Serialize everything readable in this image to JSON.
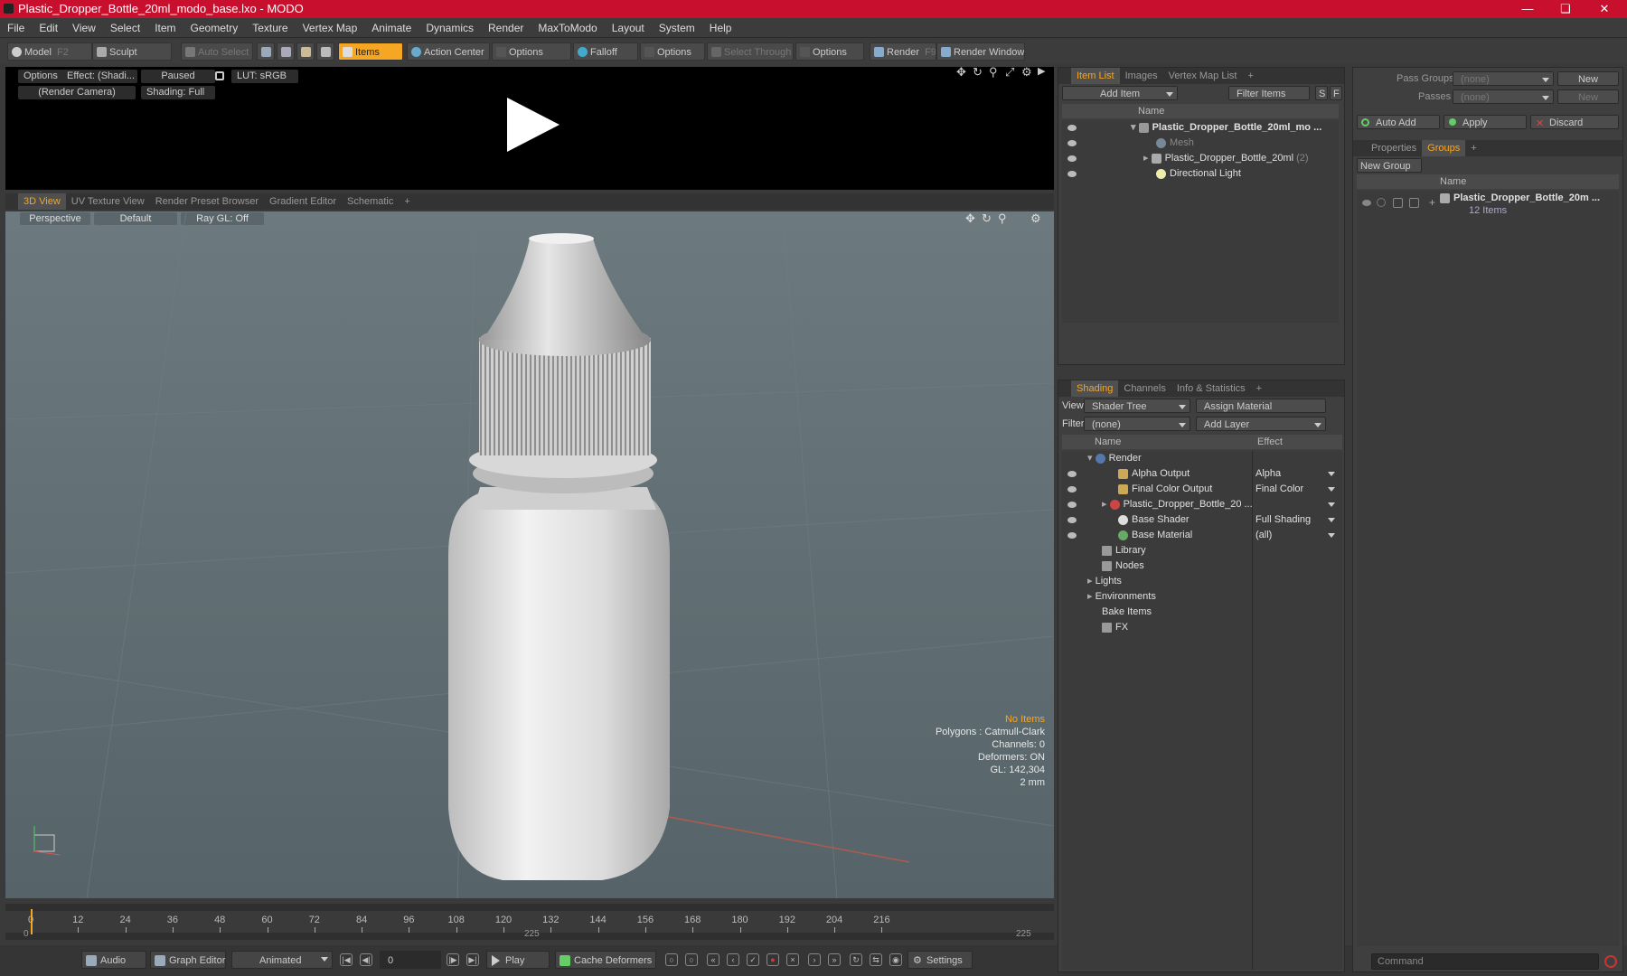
{
  "title": "Plastic_Dropper_Bottle_20ml_modo_base.lxo - MODO",
  "menu": [
    "File",
    "Edit",
    "View",
    "Select",
    "Item",
    "Geometry",
    "Texture",
    "Vertex Map",
    "Animate",
    "Dynamics",
    "Render",
    "MaxToModo",
    "Layout",
    "System",
    "Help"
  ],
  "toolbar": {
    "model": "Model",
    "model_key": "F2",
    "sculpt": "Sculpt",
    "auto_select": "Auto Select",
    "items": "Items",
    "action_center": "Action Center",
    "options1": "Options",
    "falloff": "Falloff",
    "options2": "Options",
    "select_through": "Select Through",
    "options3": "Options",
    "render": "Render",
    "render_key": "F9",
    "render_window": "Render Window"
  },
  "render_preview": {
    "options": "Options",
    "effect": "Effect: (Shadi...",
    "paused": "Paused",
    "lut": "LUT: sRGB",
    "camera": "(Render Camera)",
    "shading": "Shading: Full"
  },
  "viewport_tabs": [
    "3D View",
    "UV Texture View",
    "Render Preset Browser",
    "Gradient Editor",
    "Schematic",
    "+"
  ],
  "viewport": {
    "perspective": "Perspective",
    "default": "Default",
    "raygl": "Ray GL: Off",
    "stats": [
      "No Items",
      "Polygons : Catmull-Clark",
      "Channels: 0",
      "Deformers: ON",
      "GL: 142,304",
      "2 mm"
    ]
  },
  "timeline": {
    "ticks": [
      "0",
      "12",
      "24",
      "36",
      "48",
      "60",
      "72",
      "84",
      "96",
      "108",
      "120",
      "132",
      "144",
      "156",
      "168",
      "180",
      "192",
      "204",
      "216"
    ],
    "start": "0",
    "mid": "225",
    "end": "225"
  },
  "bottom": {
    "audio": "Audio",
    "graph_editor": "Graph Editor",
    "animated": "Animated",
    "frame": "0",
    "play": "Play",
    "cache_deformers": "Cache Deformers",
    "settings": "Settings"
  },
  "item_list": {
    "tabs": [
      "Item List",
      "Images",
      "Vertex Map List",
      "+"
    ],
    "add_item": "Add Item",
    "filter_items": "Filter Items",
    "s": "S",
    "f": "F",
    "col_name": "Name",
    "rows": [
      {
        "label": "Plastic_Dropper_Bottle_20ml_mo ...",
        "extra": ""
      },
      {
        "label": "Mesh",
        "extra": ""
      },
      {
        "label": "Plastic_Dropper_Bottle_20ml",
        "extra": "(2)"
      },
      {
        "label": "Directional Light",
        "extra": ""
      }
    ]
  },
  "shading": {
    "tabs": [
      "Shading",
      "Channels",
      "Info & Statistics",
      "+"
    ],
    "view_label": "View",
    "view_value": "Shader Tree",
    "assign_material": "Assign Material",
    "filter_label": "Filter",
    "filter_value": "(none)",
    "add_layer": "Add Layer",
    "col_name": "Name",
    "col_effect": "Effect",
    "rows": [
      {
        "name": "Render",
        "effect": ""
      },
      {
        "name": "Alpha Output",
        "effect": "Alpha"
      },
      {
        "name": "Final Color Output",
        "effect": "Final Color"
      },
      {
        "name": "Plastic_Dropper_Bottle_20 ...",
        "effect": ""
      },
      {
        "name": "Base Shader",
        "effect": "Full Shading"
      },
      {
        "name": "Base Material",
        "effect": "(all)"
      },
      {
        "name": "Library",
        "effect": ""
      },
      {
        "name": "Nodes",
        "effect": ""
      },
      {
        "name": "Lights",
        "effect": ""
      },
      {
        "name": "Environments",
        "effect": ""
      },
      {
        "name": "Bake Items",
        "effect": ""
      },
      {
        "name": "FX",
        "effect": ""
      }
    ]
  },
  "passes": {
    "pass_groups": "Pass Groups",
    "passes": "Passes",
    "none": "(none)",
    "new": "New",
    "auto_add": "Auto Add",
    "apply": "Apply",
    "discard": "Discard"
  },
  "groups": {
    "tabs": [
      "Properties",
      "Groups",
      "+"
    ],
    "new_group": "New Group",
    "col_name": "Name",
    "item_name": "Plastic_Dropper_Bottle_20m ...",
    "item_count": "12 Items"
  },
  "command_placeholder": "Command"
}
